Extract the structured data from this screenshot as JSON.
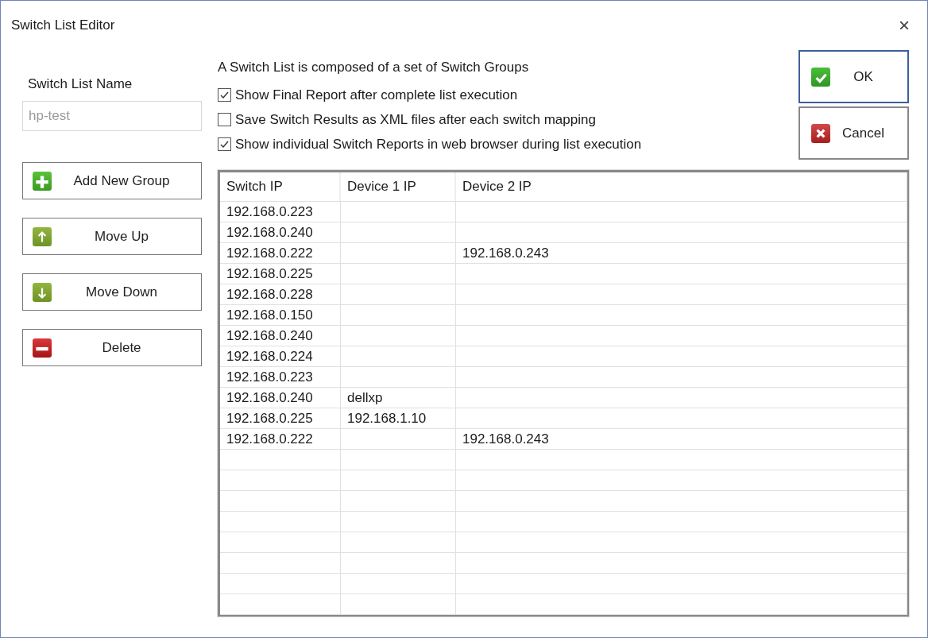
{
  "window": {
    "title": "Switch List Editor",
    "close": "×"
  },
  "name_field": {
    "label": "Switch List Name",
    "value": "hp-test",
    "disabled": true
  },
  "left_buttons": [
    {
      "kind": "add",
      "label": "Add New Group"
    },
    {
      "kind": "up",
      "label": "Move Up"
    },
    {
      "kind": "down",
      "label": "Move Down"
    },
    {
      "kind": "delete",
      "label": "Delete"
    }
  ],
  "description": "A Switch List is composed of a set of Switch Groups",
  "options": [
    {
      "label": "Show Final Report after complete list execution",
      "checked": true
    },
    {
      "label": "Save Switch Results as XML files after each switch mapping",
      "checked": false
    },
    {
      "label": "Show individual Switch Reports in web browser during list execution",
      "checked": true
    }
  ],
  "dialog_buttons": [
    {
      "kind": "ok",
      "label": "OK",
      "focused": true
    },
    {
      "kind": "cancel",
      "label": "Cancel",
      "focused": false
    }
  ],
  "table": {
    "columns": [
      "Switch IP",
      "Device 1 IP",
      "Device 2 IP"
    ],
    "rows": [
      [
        "192.168.0.223",
        "",
        ""
      ],
      [
        "192.168.0.240",
        "",
        ""
      ],
      [
        "192.168.0.222",
        "",
        "192.168.0.243"
      ],
      [
        "192.168.0.225",
        "",
        ""
      ],
      [
        "192.168.0.228",
        "",
        ""
      ],
      [
        "192.168.0.150",
        "",
        ""
      ],
      [
        "192.168.0.240",
        "",
        ""
      ],
      [
        "192.168.0.224",
        "",
        ""
      ],
      [
        "192.168.0.223",
        "",
        ""
      ],
      [
        "192.168.0.240",
        "dellxp",
        ""
      ],
      [
        "192.168.0.225",
        "192.168.1.10",
        ""
      ],
      [
        "192.168.0.222",
        "",
        "192.168.0.243"
      ]
    ]
  }
}
